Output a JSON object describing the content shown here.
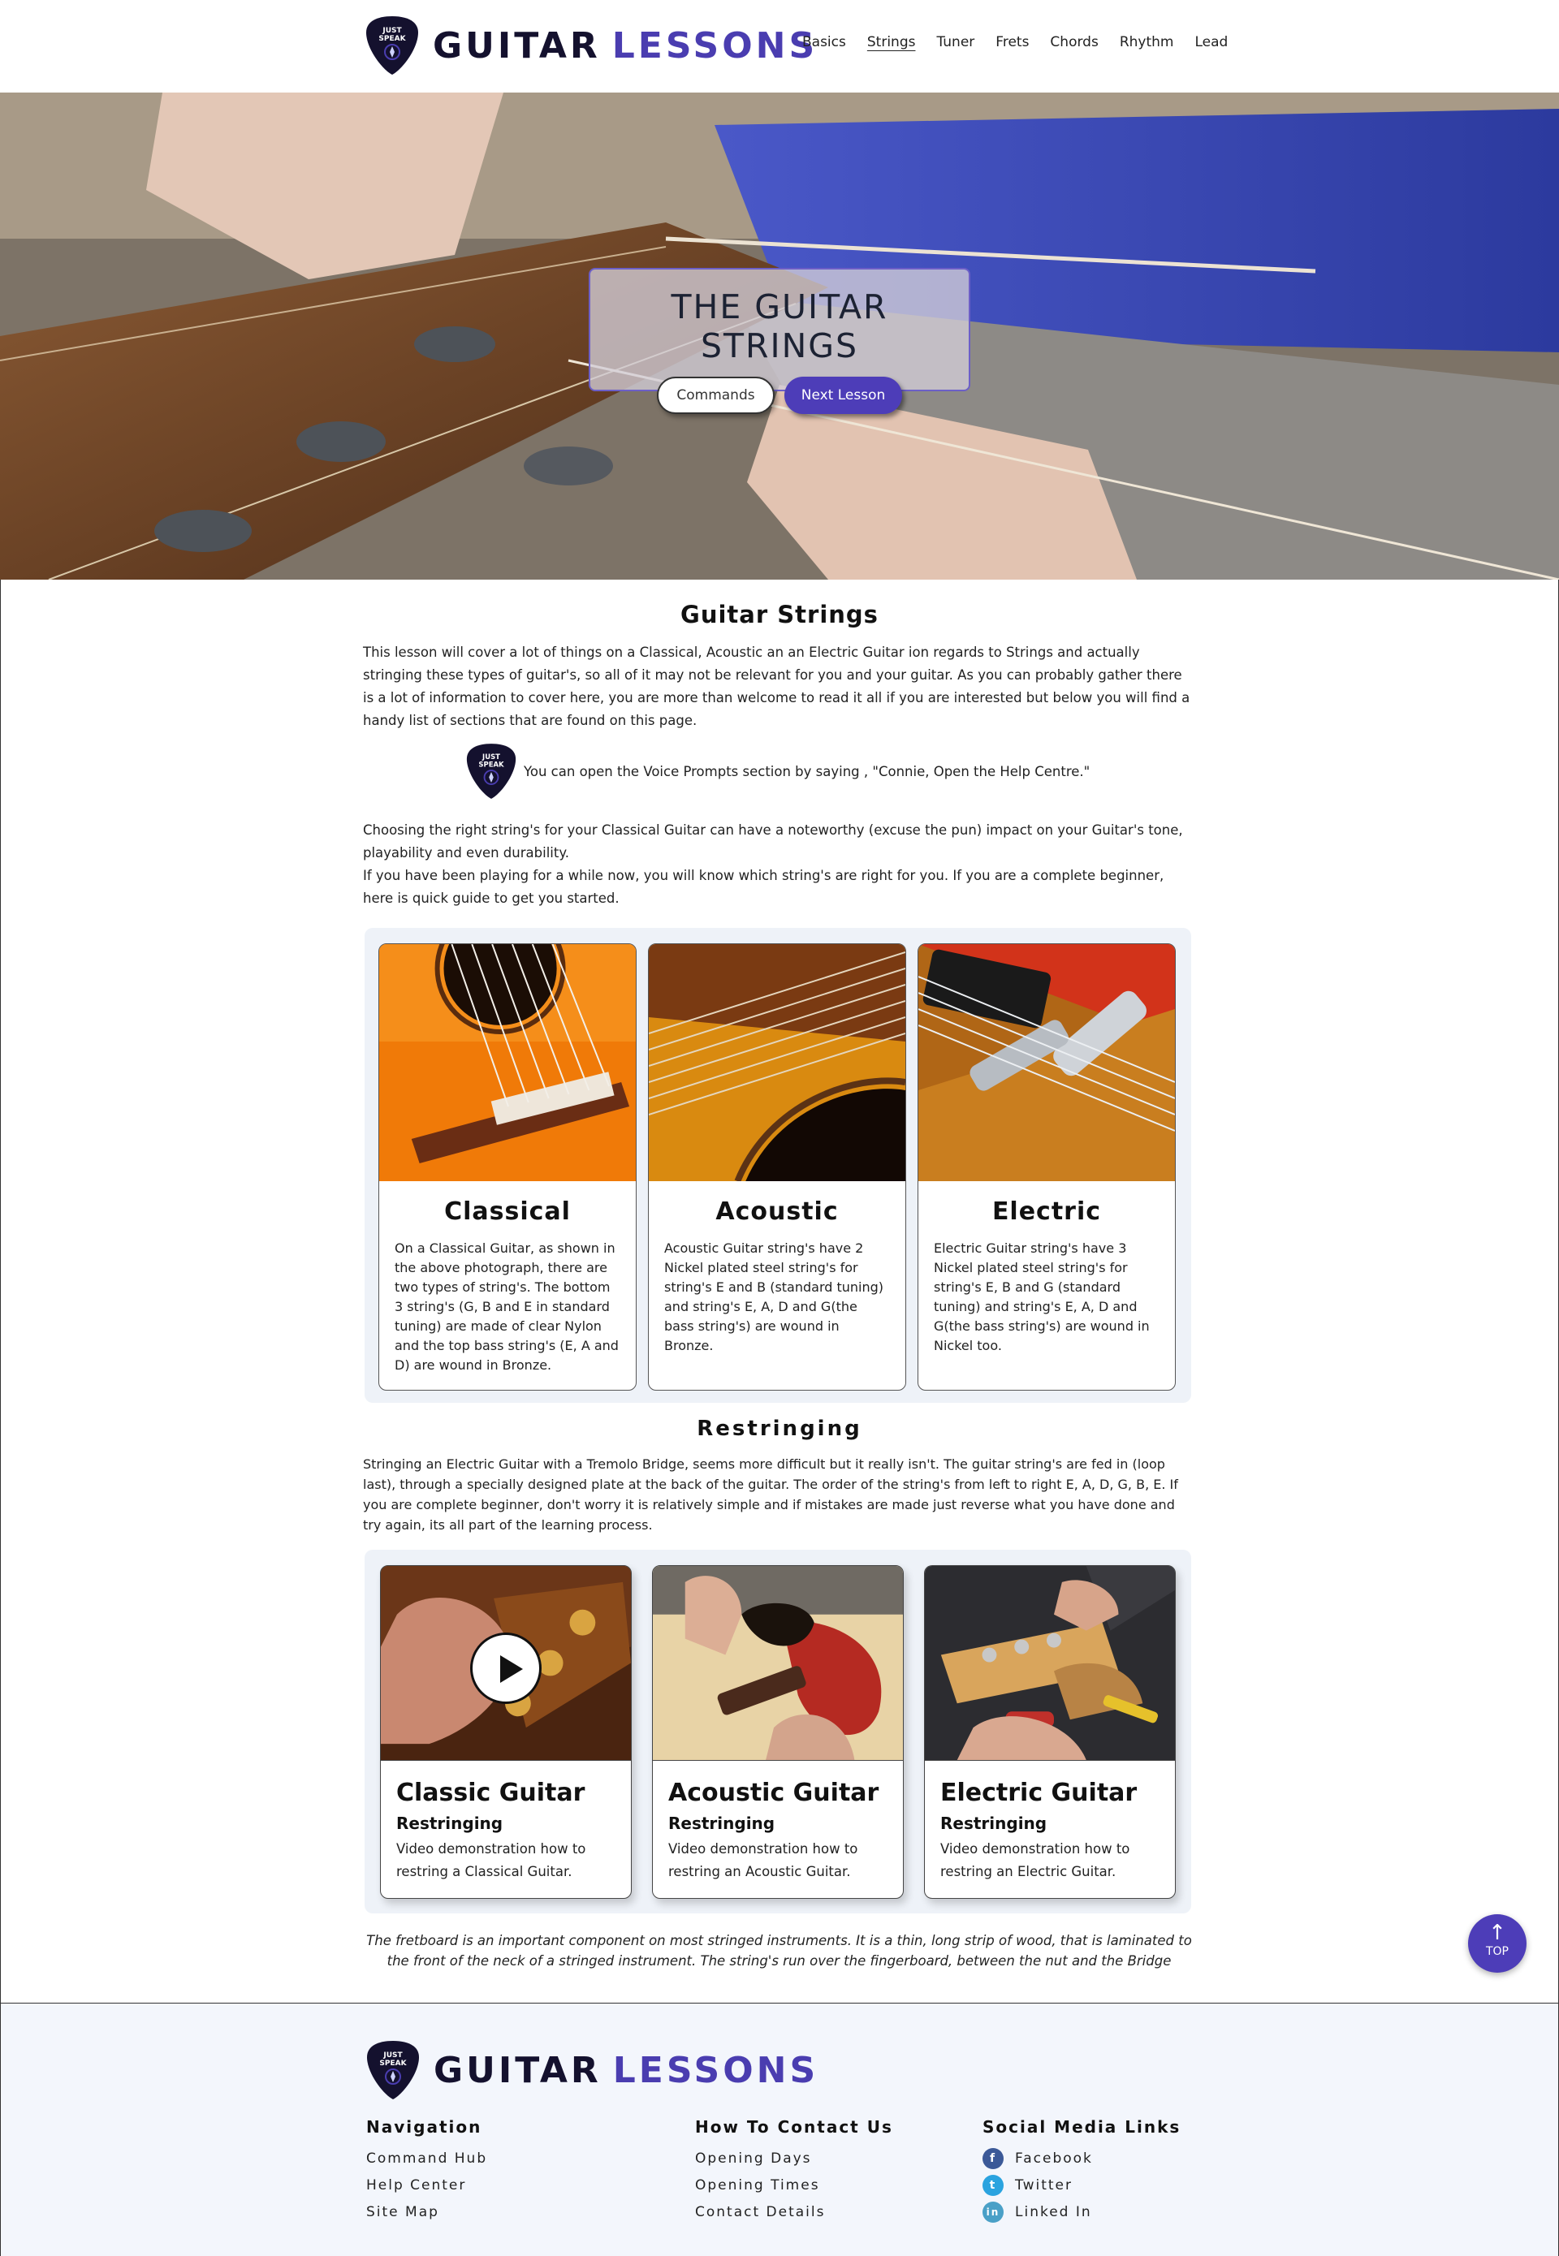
{
  "brand": {
    "word1": "GUITAR",
    "word2": "LESSONS",
    "pick_text": "JUST SPEAK"
  },
  "nav": [
    {
      "label": "Basics"
    },
    {
      "label": "Strings",
      "active": true
    },
    {
      "label": "Tuner"
    },
    {
      "label": "Frets"
    },
    {
      "label": "Chords"
    },
    {
      "label": "Rhythm"
    },
    {
      "label": "Lead"
    }
  ],
  "hero": {
    "title": "THE GUITAR STRINGS",
    "commands_label": "Commands",
    "next_label": "Next Lesson"
  },
  "intro": {
    "heading": "Guitar Strings",
    "text": "This lesson will cover a lot of things on a Classical, Acoustic an an Electric Guitar ion regards to Strings and actually stringing these types of guitar's, so all of it may not be relevant for you and your guitar. As you can probably gather there is a lot of information to cover here, you are more than welcome to read it all if you are interested but below you will find a handy list of sections that are found on this page.",
    "voice_prompt": "You can open the Voice Prompts section by saying , \"Connie, Open the Help Centre.\"",
    "choose_text_1": "Choosing the right string's for your Classical Guitar can have a noteworthy (excuse the pun) impact on your Guitar's tone, playability and even durability.",
    "choose_text_2": "If you have been playing for a while now, you will know which string's are right for you. If you are a complete beginner, here is quick guide to get you started."
  },
  "string_types": [
    {
      "title": "Classical",
      "text": "On a Classical Guitar, as shown in the above photograph, there are two types of string's. The bottom 3 string's (G, B and E in standard tuning) are made of clear Nylon and the top bass string's (E, A and D) are wound in Bronze."
    },
    {
      "title": "Acoustic",
      "text": "Acoustic Guitar string's have 2 Nickel plated steel string's for string's E and B (standard tuning) and string's E, A, D and G(the bass string's) are wound in Bronze."
    },
    {
      "title": "Electric",
      "text": "Electric Guitar string's have 3 Nickel plated steel string's for string's E, B and G (standard tuning) and string's E, A, D and G(the bass string's) are wound in Nickel too."
    }
  ],
  "restringing": {
    "heading": "Restringing",
    "text": "Stringing an Electric Guitar with a Tremolo Bridge, seems more difficult but it really isn't. The guitar string's are fed in (loop last), through a specially designed plate at the back of the guitar. The order of the string's from left to right E, A, D, G, B, E. If you are complete beginner, don't worry it is relatively simple and if mistakes are made just reverse what you have done and try again, its all part of the learning process."
  },
  "videos": [
    {
      "title": "Classic Guitar",
      "subtitle": "Restringing",
      "text": "Video demonstration how to restring a Classical Guitar."
    },
    {
      "title": "Acoustic Guitar",
      "subtitle": "Restringing",
      "text": "Video demonstration how to restring an Acoustic Guitar."
    },
    {
      "title": "Electric Guitar",
      "subtitle": "Restringing",
      "text": "Video demonstration how to restring an Electric Guitar."
    }
  ],
  "fretboard_note": "The fretboard is an important component on most stringed instruments. It is a thin, long strip of wood, that is laminated to the front of the neck of a stringed instrument. The string's run over the fingerboard, between the nut and the Bridge",
  "top_button": {
    "label": "TOP",
    "icon": "arrow-up-icon"
  },
  "footer": {
    "navigation": {
      "heading": "Navigation",
      "links": [
        "Command Hub",
        "Help Center",
        "Site Map"
      ]
    },
    "contact": {
      "heading": "How To Contact Us",
      "links": [
        "Opening Days",
        "Opening Times",
        "Contact Details"
      ]
    },
    "social": {
      "heading": "Social Media Links",
      "links": [
        {
          "label": "Facebook",
          "icon": "facebook-icon",
          "glyph": "f",
          "color": "#3b5998"
        },
        {
          "label": "Twitter",
          "icon": "twitter-icon",
          "glyph": "t",
          "color": "#2aa3df"
        },
        {
          "label": "Linked In",
          "icon": "linkedin-icon",
          "glyph": "in",
          "color": "#4aa0c7"
        }
      ]
    }
  },
  "colors": {
    "accent": "#4d3db8",
    "brand_dark": "#14112e",
    "panel_bg": "#eef2f8",
    "footer_bg": "#f3f6fc"
  }
}
